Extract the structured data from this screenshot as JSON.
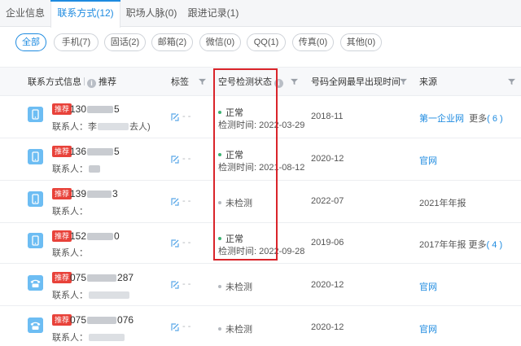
{
  "tabs": [
    {
      "label": "企业信息",
      "active": false
    },
    {
      "label": "联系方式(12)",
      "active": true
    },
    {
      "label": "职场人脉(0)",
      "active": false
    },
    {
      "label": "跟进记录(1)",
      "active": false
    }
  ],
  "filters": [
    {
      "label": "全部",
      "active": true
    },
    {
      "label": "手机(7)",
      "active": false
    },
    {
      "label": "固话(2)",
      "active": false
    },
    {
      "label": "邮箱(2)",
      "active": false
    },
    {
      "label": "微信(0)",
      "active": false
    },
    {
      "label": "QQ(1)",
      "active": false
    },
    {
      "label": "传真(0)",
      "active": false
    },
    {
      "label": "其他(0)",
      "active": false
    }
  ],
  "columns": {
    "info": "联系方式信息",
    "recommend": "推荐",
    "tag": "标签",
    "status": "空号检测状态",
    "earliest": "号码全网最早出现时间",
    "source": "来源"
  },
  "rows": [
    {
      "type": "mobile",
      "badge": "推荐",
      "num_prefix": "130",
      "num_suffix": "5",
      "contact_label": "联系人：",
      "contact_prefix": "李",
      "contact_suffix": "去人)",
      "tag_dashes": "- -",
      "status": "正常",
      "status_ok": true,
      "check_label": "检测时间: 2022-03-29",
      "date": "2018-11",
      "source": "第一企业网",
      "source_link": true,
      "more": "更多",
      "more_count": "( 6 )"
    },
    {
      "type": "mobile",
      "badge": "推荐",
      "num_prefix": "136",
      "num_suffix": "5",
      "contact_label": "联系人：",
      "contact_prefix": "",
      "contact_suffix": "",
      "tag_dashes": "- -",
      "status": "正常",
      "status_ok": true,
      "check_label": "检测时间: 2021-08-12",
      "date": "2020-12",
      "source": "官网",
      "source_link": true,
      "more": "",
      "more_count": ""
    },
    {
      "type": "mobile",
      "badge": "推荐",
      "num_prefix": "139",
      "num_suffix": "3",
      "contact_label": "联系人：",
      "contact_prefix": "",
      "contact_suffix": "",
      "tag_dashes": "- -",
      "status": "未检测",
      "status_ok": false,
      "check_label": "",
      "date": "2022-07",
      "source": "2021年年报",
      "source_link": false,
      "more": "",
      "more_count": ""
    },
    {
      "type": "mobile",
      "badge": "推荐",
      "num_prefix": "152",
      "num_suffix": "0",
      "contact_label": "联系人：",
      "contact_prefix": "",
      "contact_suffix": "",
      "tag_dashes": "- -",
      "status": "正常",
      "status_ok": true,
      "check_label": "检测时间: 2022-09-28",
      "date": "2019-06",
      "source": "2017年年报",
      "source_link": false,
      "more": "更多",
      "more_count": "( 4 )"
    },
    {
      "type": "landline",
      "badge": "推荐",
      "num_prefix": "075",
      "num_suffix": "287",
      "contact_label": "联系人：",
      "contact_prefix": "",
      "contact_suffix": "",
      "tag_dashes": "- -",
      "status": "未检测",
      "status_ok": false,
      "check_label": "",
      "date": "2020-12",
      "source": "官网",
      "source_link": true,
      "more": "",
      "more_count": ""
    },
    {
      "type": "landline",
      "badge": "推荐",
      "num_prefix": "075",
      "num_suffix": "076",
      "contact_label": "联系人：",
      "contact_prefix": "",
      "contact_suffix": "",
      "tag_dashes": "- -",
      "status": "未检测",
      "status_ok": false,
      "check_label": "",
      "date": "2020-12",
      "source": "官网",
      "source_link": true,
      "more": "",
      "more_count": ""
    }
  ],
  "colors": {
    "accent": "#1e8be0",
    "badge": "#e8423a",
    "ok": "#3cb371",
    "unchecked": "#b5b9bf",
    "highlight": "#d9242a"
  }
}
